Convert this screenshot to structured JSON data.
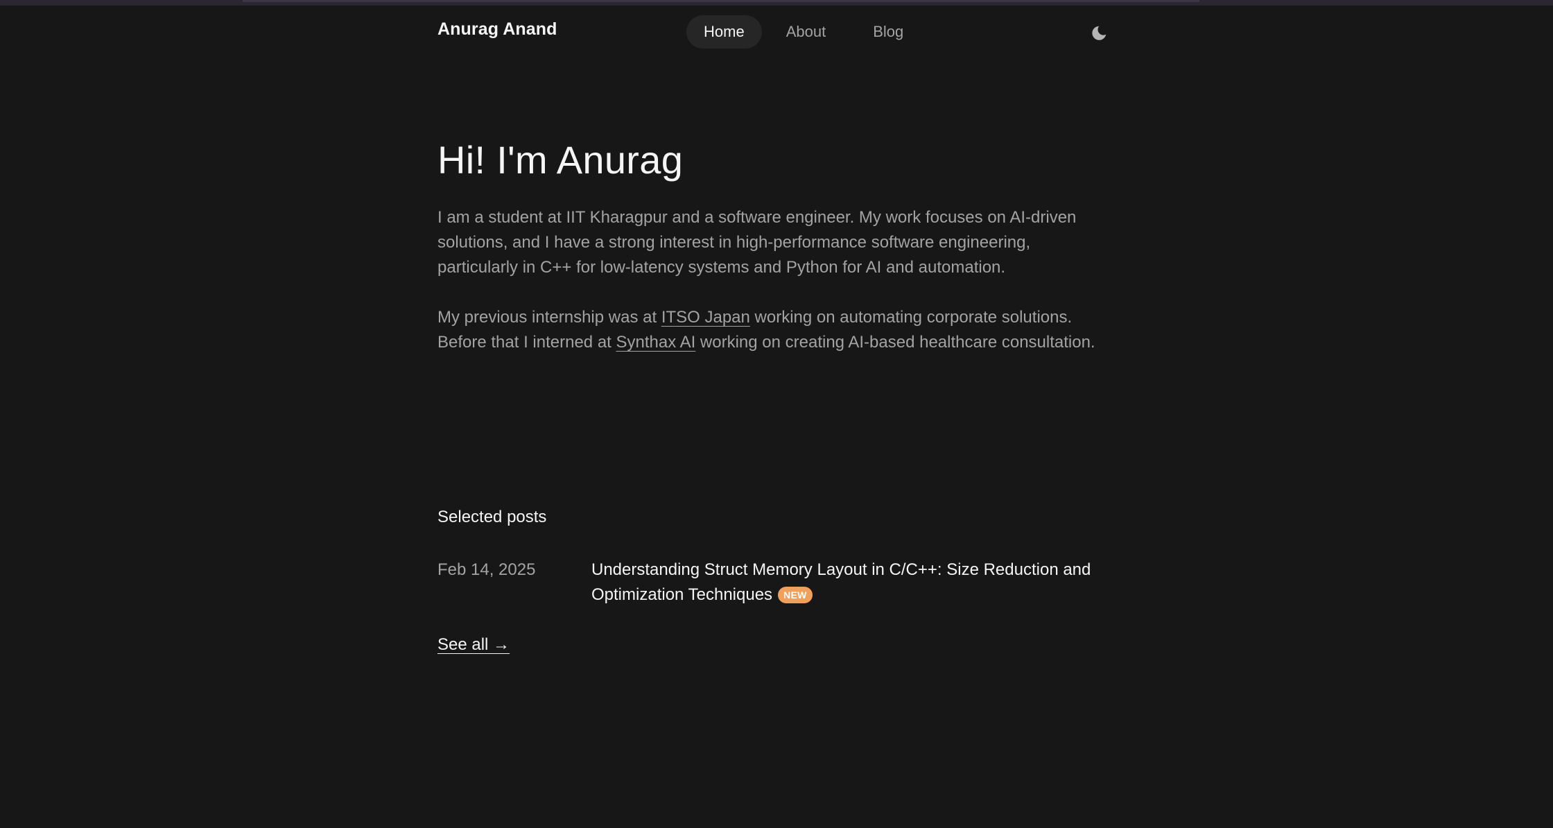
{
  "header": {
    "brand": "Anurag Anand",
    "nav": [
      {
        "label": "Home",
        "active": true
      },
      {
        "label": "About",
        "active": false
      },
      {
        "label": "Blog",
        "active": false
      }
    ],
    "theme_toggle_icon": "moon-icon"
  },
  "hero": {
    "title": "Hi! I'm Anurag",
    "p1": "I am a student at IIT Kharagpur and a software engineer. My work focuses on AI-driven solutions, and I have a strong interest in high-performance software engineering, particularly in C++ for low-latency systems and Python for AI and automation.",
    "p2_before": "My previous internship was at ",
    "p2_link1": "ITSO Japan",
    "p2_middle": " working on automating corporate solutions. Before that I interned at ",
    "p2_link2": "Synthax AI",
    "p2_after": " working on creating AI-based healthcare consultation."
  },
  "posts": {
    "title": "Selected posts",
    "items": [
      {
        "date": "Feb 14, 2025",
        "title": "Understanding Struct Memory Layout in C/C++: Size Reduction and Optimization Techniques",
        "badge": "NEW"
      }
    ],
    "see_all": "See all →"
  },
  "colors": {
    "background": "#171717",
    "text_primary": "#f5f5f5",
    "text_muted": "#a3a3a3",
    "badge": "#f0a05a"
  }
}
